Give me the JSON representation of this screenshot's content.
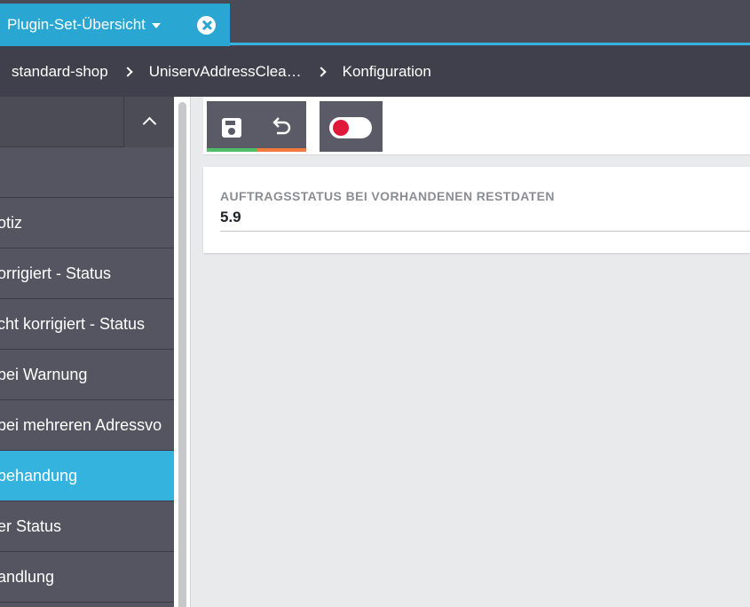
{
  "tab": {
    "label": "Plugin-Set-Übersicht"
  },
  "breadcrumb": [
    "standard-shop",
    "UniservAddressClea…",
    "Konfiguration"
  ],
  "sidebar": {
    "items": [
      {
        "label": ""
      },
      {
        "label": "otiz"
      },
      {
        "label": "orrigiert - Status"
      },
      {
        "label": "cht korrigiert - Status"
      },
      {
        "label": "bei Warnung"
      },
      {
        "label": "bei mehreren Adressvo"
      },
      {
        "label": "behandung",
        "active": true
      },
      {
        "label": "er Status"
      },
      {
        "label": "andlung"
      }
    ]
  },
  "toolbar": {
    "save_icon": "save-icon",
    "undo_icon": "undo-icon",
    "toggle_icon": "toggle-icon",
    "colors": {
      "save_bar": "#4fbf67",
      "undo_bar": "#f07b3c",
      "toggle_off": "#e0183a"
    }
  },
  "form": {
    "field_label": "AUFTRAGSSTATUS BEI VORHANDENEN RESTDATEN",
    "field_value": "5.9"
  },
  "colors": {
    "accent": "#34b3de",
    "sidebar_bg": "#545560",
    "header_bg": "#3f404b"
  }
}
